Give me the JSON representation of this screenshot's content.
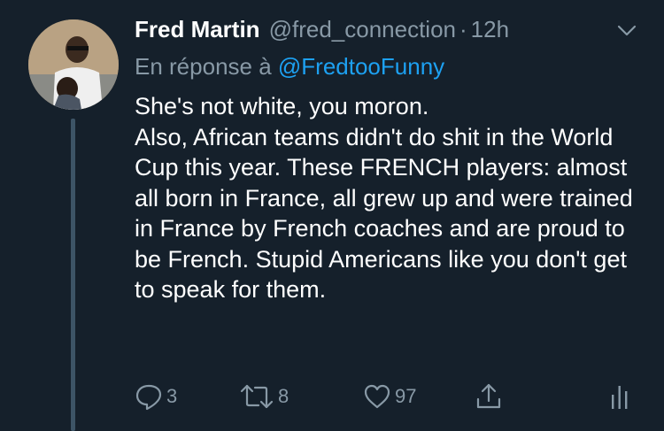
{
  "tweet": {
    "author_name": "Fred Martin",
    "author_handle": "@fred_connection",
    "separator": "·",
    "time": "12h",
    "reply_prefix": "En réponse à ",
    "reply_to": "@FredtooFunny",
    "text_line1": "She's not white, you moron.",
    "text_line2": "Also, African teams didn't do shit in the World Cup this year. These FRENCH players: almost all born in France, all grew up and were trained in France by French coaches and are proud to be French. Stupid Americans like you don't get to speak for them."
  },
  "actions": {
    "reply_count": "3",
    "retweet_count": "8",
    "like_count": "97"
  },
  "colors": {
    "background": "#15202b",
    "muted": "#8899a6",
    "link": "#1da1f2",
    "thread_line": "#3d5466"
  }
}
